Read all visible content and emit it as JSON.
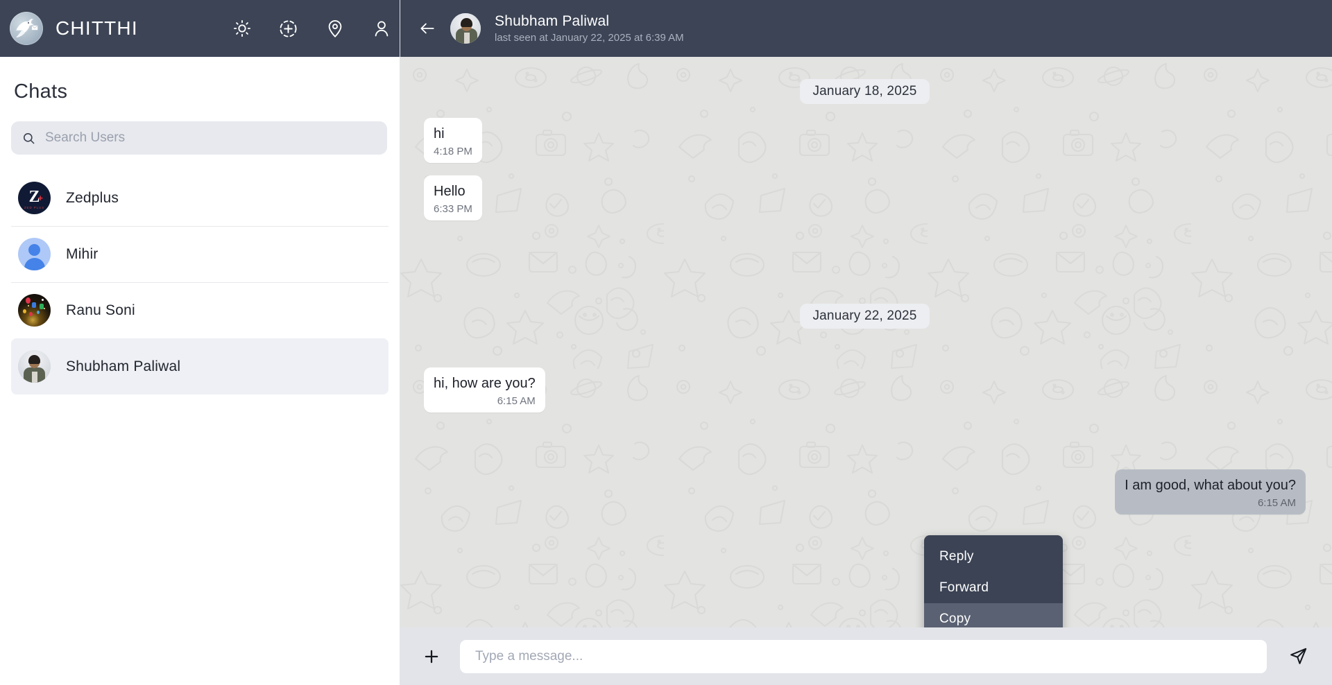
{
  "app": {
    "brand_title": "CHITTHI",
    "logo_icon": "dove-with-letter-logo",
    "header_icons": [
      {
        "name": "brightness-icon",
        "label": "Theme"
      },
      {
        "name": "add-circle-icon",
        "label": "New Chat"
      },
      {
        "name": "location-pin-icon",
        "label": "Location"
      },
      {
        "name": "profile-icon",
        "label": "Profile"
      }
    ]
  },
  "sidebar": {
    "title": "Chats",
    "search": {
      "placeholder": "Search Users",
      "value": "",
      "icon": "search-icon"
    },
    "items": [
      {
        "name": "Zedplus",
        "avatar": "zedplus-logo",
        "selected": false
      },
      {
        "name": "Mihir",
        "avatar": "default-user",
        "selected": false
      },
      {
        "name": "Ranu Soni",
        "avatar": "party-photo",
        "selected": false
      },
      {
        "name": "Shubham Paliwal",
        "avatar": "person-photo",
        "selected": true
      }
    ]
  },
  "conversation": {
    "back_icon": "back-arrow-icon",
    "contact_name": "Shubham Paliwal",
    "contact_status": "last seen at January 22, 2025 at 6:39 AM",
    "contact_avatar": "person-photo",
    "groups": [
      {
        "date": "January 18, 2025",
        "messages": [
          {
            "text": "hi",
            "time": "4:18 PM",
            "direction": "in"
          },
          {
            "text": "Hello",
            "time": "6:33 PM",
            "direction": "in"
          }
        ]
      },
      {
        "date": "January 22, 2025",
        "messages": [
          {
            "text": "hi, how are you?",
            "time": "6:15 AM",
            "direction": "in"
          },
          {
            "text": "I am good, what about you?",
            "time": "6:15 AM",
            "direction": "out"
          }
        ]
      }
    ]
  },
  "context_menu": {
    "items": [
      {
        "label": "Reply",
        "active": false
      },
      {
        "label": "Forward",
        "active": false
      },
      {
        "label": "Copy",
        "active": true
      }
    ]
  },
  "composer": {
    "attach_icon": "plus-icon",
    "placeholder": "Type a message...",
    "value": "",
    "send_icon": "send-paper-plane-icon"
  },
  "colors": {
    "header_bg": "#3c4455",
    "chat_bg": "#e3e3e1",
    "incoming_bubble": "#ffffff",
    "outgoing_bubble": "#b7bcc4",
    "menu_bg": "#3b4354",
    "menu_active": "#5a6172",
    "selected_item": "#eef0f5"
  }
}
